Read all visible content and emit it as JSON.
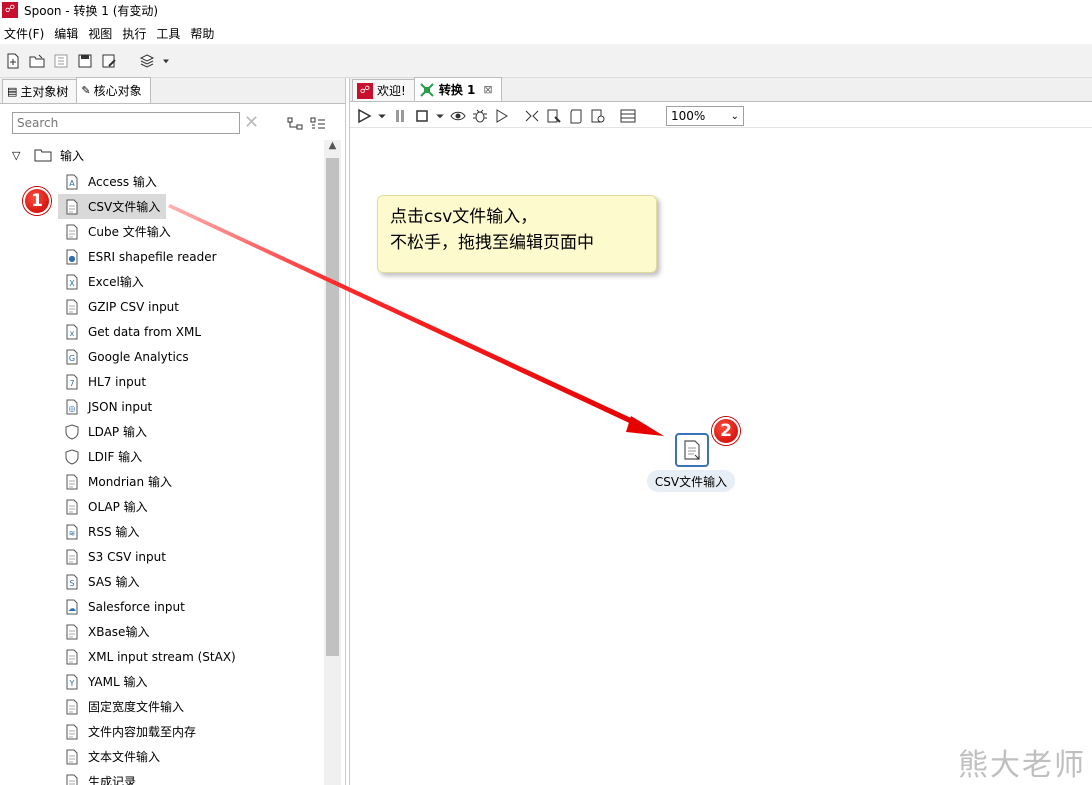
{
  "window": {
    "title": "Spoon - 转换 1 (有变动)",
    "app_icon": "spoon-logo-icon"
  },
  "menu": [
    "文件(F)",
    "编辑",
    "视图",
    "执行",
    "工具",
    "帮助"
  ],
  "left_panel": {
    "tabs": [
      {
        "label": "主对象树",
        "icon": "tree-icon",
        "active": false
      },
      {
        "label": "核心对象",
        "icon": "pencil-icon",
        "active": true
      }
    ],
    "search": {
      "value": "",
      "placeholder": "Search"
    },
    "folder": {
      "label": "输入",
      "expanded": true
    },
    "items": [
      {
        "label": "Access 输入",
        "icon": "access-icon"
      },
      {
        "label": "CSV文件输入",
        "icon": "csv-file-icon",
        "selected": true
      },
      {
        "label": "Cube 文件输入",
        "icon": "cube-file-icon"
      },
      {
        "label": "ESRI shapefile reader",
        "icon": "map-pin-icon"
      },
      {
        "label": "Excel输入",
        "icon": "excel-icon"
      },
      {
        "label": "GZIP CSV input",
        "icon": "gzip-file-icon"
      },
      {
        "label": "Get data from XML",
        "icon": "xml-file-icon"
      },
      {
        "label": "Google Analytics",
        "icon": "google-analytics-icon"
      },
      {
        "label": "HL7 input",
        "icon": "hl7-icon"
      },
      {
        "label": "JSON input",
        "icon": "json-icon"
      },
      {
        "label": "LDAP 输入",
        "icon": "ldap-shield-icon"
      },
      {
        "label": "LDIF 输入",
        "icon": "ldif-shield-icon"
      },
      {
        "label": "Mondrian 输入",
        "icon": "mondrian-cube-icon"
      },
      {
        "label": "OLAP 输入",
        "icon": "olap-cube-icon"
      },
      {
        "label": "RSS 输入",
        "icon": "rss-icon"
      },
      {
        "label": "S3 CSV input",
        "icon": "s3-file-icon"
      },
      {
        "label": "SAS 输入",
        "icon": "sas-icon"
      },
      {
        "label": "Salesforce input",
        "icon": "salesforce-icon"
      },
      {
        "label": "XBase输入",
        "icon": "xbase-icon"
      },
      {
        "label": "XML input stream (StAX)",
        "icon": "xml-stream-icon"
      },
      {
        "label": "YAML 输入",
        "icon": "yaml-icon"
      },
      {
        "label": "固定宽度文件输入",
        "icon": "fixed-width-file-icon"
      },
      {
        "label": "文件内容加载至内存",
        "icon": "load-file-icon"
      },
      {
        "label": "文本文件输入",
        "icon": "text-file-icon"
      },
      {
        "label": "生成记录",
        "icon": "generate-rows-icon"
      }
    ]
  },
  "editor": {
    "tabs": [
      {
        "label": "欢迎!",
        "icon": "spoon-logo-icon",
        "active": false
      },
      {
        "label": "转换 1",
        "icon": "transformation-icon",
        "active": true,
        "close": "⊠"
      }
    ],
    "zoom": "100%",
    "note": {
      "line1": "点击csv文件输入，",
      "line2": "不松手，拖拽至编辑页面中"
    },
    "step": {
      "label": "CSV文件输入",
      "icon": "csv-file-icon"
    }
  },
  "annotations": {
    "badge1": "1",
    "badge2": "2"
  },
  "watermark": "熊大老师",
  "colors": {
    "arrow": "#ff0000",
    "badge": "#d40000",
    "note_bg": "#fdfacd",
    "step_border": "#3b73b9"
  }
}
